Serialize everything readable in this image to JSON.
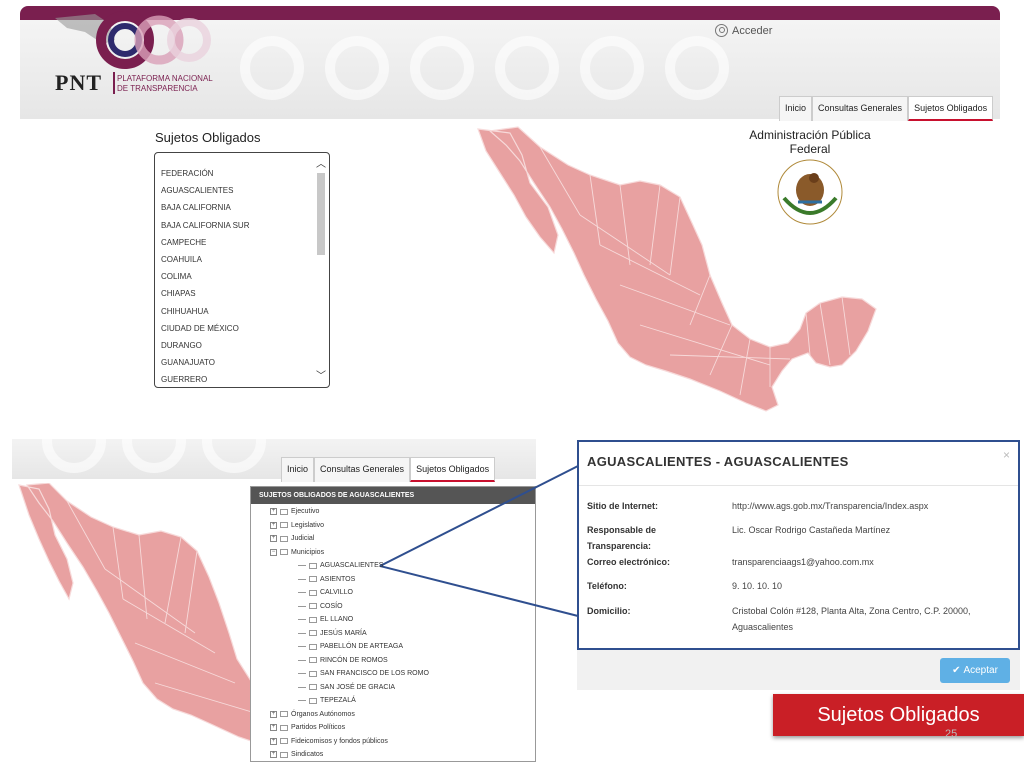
{
  "header": {
    "logo_text": "PNT",
    "logo_sub": [
      "Plataforma Nacional",
      "de Transparencia"
    ],
    "login_label": "Acceder",
    "tabs": [
      "Inicio",
      "Consultas Generales",
      "Sujetos Obligados"
    ]
  },
  "sujetos": {
    "title": "Sujetos Obligados",
    "items": [
      "FEDERACIÓN",
      "AGUASCALIENTES",
      "BAJA CALIFORNIA",
      "BAJA CALIFORNIA SUR",
      "CAMPECHE",
      "COAHUILA",
      "COLIMA",
      "CHIAPAS",
      "CHIHUAHUA",
      "CIUDAD DE MÉXICO",
      "DURANGO",
      "GUANAJUATO",
      "GUERRERO"
    ]
  },
  "federal": {
    "line1": "Administración Pública",
    "line2": "Federal",
    "seal": "ESTADOS UNIDOS MEXICANOS"
  },
  "tree": {
    "header": "SUJETOS OBLIGADOS DE AGUASCALIENTES",
    "top_nodes": [
      "Ejecutivo",
      "Legislativo",
      "Judicial",
      "Municipios"
    ],
    "municipios": [
      "AGUASCALIENTES",
      "ASIENTOS",
      "CALVILLO",
      "COSÍO",
      "EL LLANO",
      "JESÚS MARÍA",
      "PABELLÓN DE ARTEAGA",
      "RINCÓN DE ROMOS",
      "SAN FRANCISCO DE LOS ROMO",
      "SAN JOSÉ DE GRACIA",
      "TEPEZALÁ"
    ],
    "bottom_nodes": [
      "Órganos Autónomos",
      "Partidos Políticos",
      "Fideicomisos y fondos públicos",
      "Sindicatos"
    ]
  },
  "modal": {
    "title": "AGUASCALIENTES - AGUASCALIENTES",
    "close": "×",
    "fields": [
      {
        "label": "Sitio de Internet:",
        "value": "http://www.ags.gob.mx/Transparencia/Index.aspx"
      },
      {
        "label": "Responsable de Transparencia:",
        "value": "Lic. Oscar Rodrigo Castañeda Martínez"
      },
      {
        "label": "Correo electrónico:",
        "value": "transparenciaags1@yahoo.com.mx"
      },
      {
        "label": "Teléfono:",
        "value": "9. 10. 10. 10"
      },
      {
        "label": "Domicilio:",
        "value": "Cristobal Colón #128, Planta Alta, Zona Centro, C.P. 20000, Aguascalientes"
      }
    ],
    "accept_label": "Aceptar"
  },
  "badge": "Sujetos Obligados",
  "page_number": "25",
  "colors": {
    "brand": "#7a1f4f",
    "map": "#e8a1a1",
    "badge": "#c91f26",
    "modal_border": "#2f4f8f",
    "button": "#5fb0e5"
  }
}
